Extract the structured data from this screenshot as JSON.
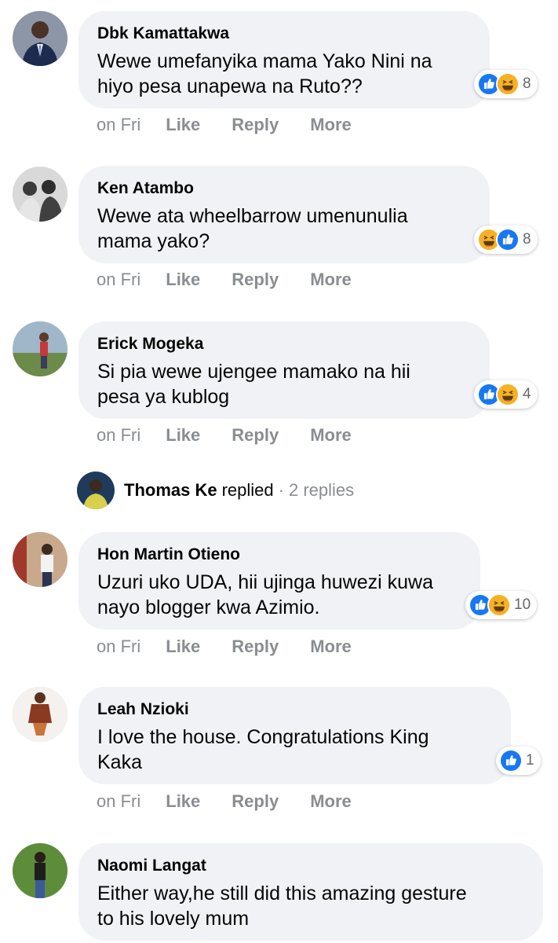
{
  "colors": {
    "bubble": "#f0f2f5",
    "like_blue": "#1877f2",
    "haha_yellow": "#f7b125",
    "muted_text": "#8a8d91"
  },
  "comments": [
    {
      "author": "Dbk Kamattakwa",
      "text_line1": "Wewe umefanyika mama Yako Nini na",
      "text_line2": "hiyo pesa unapewa na Ruto??",
      "reactions": [
        "like-icon",
        "haha-icon"
      ],
      "reaction_count": "8",
      "time": "on Fri",
      "like": "Like",
      "reply": "Reply",
      "more": "More"
    },
    {
      "author": "Ken Atambo",
      "text_line1": "Wewe ata wheelbarrow umenunulia",
      "text_line2": "mama yako?",
      "reactions": [
        "haha-icon",
        "like-icon"
      ],
      "reaction_count": "8",
      "time": "on Fri",
      "like": "Like",
      "reply": "Reply",
      "more": "More"
    },
    {
      "author": "Erick Mogeka",
      "text_line1": "Si pia wewe ujengee mamako na hii",
      "text_line2": "pesa ya kublog",
      "reactions": [
        "like-icon",
        "haha-icon"
      ],
      "reaction_count": "4",
      "time": "on Fri",
      "like": "Like",
      "reply": "Reply",
      "more": "More"
    },
    {
      "author": "Hon Martin Otieno",
      "text_line1": "Uzuri uko UDA, hii ujinga huwezi kuwa",
      "text_line2": "nayo blogger kwa Azimio.",
      "reactions": [
        "like-icon",
        "haha-icon"
      ],
      "reaction_count": "10",
      "time": "on Fri",
      "like": "Like",
      "reply": "Reply",
      "more": "More"
    },
    {
      "author": "Leah Nzioki",
      "text_line1": "I love the house. Congratulations King",
      "text_line2": "Kaka",
      "reactions": [
        "like-icon"
      ],
      "reaction_count": "1",
      "time": "on Fri",
      "like": "Like",
      "reply": "Reply",
      "more": "More"
    },
    {
      "author": "Naomi Langat",
      "text_line1": "Either way,he still did this amazing gesture",
      "text_line2": "to his lovely mum"
    }
  ],
  "reply_summary": {
    "name": "Thomas Ke",
    "verb": "replied",
    "dot": "·",
    "count": "2 replies"
  }
}
